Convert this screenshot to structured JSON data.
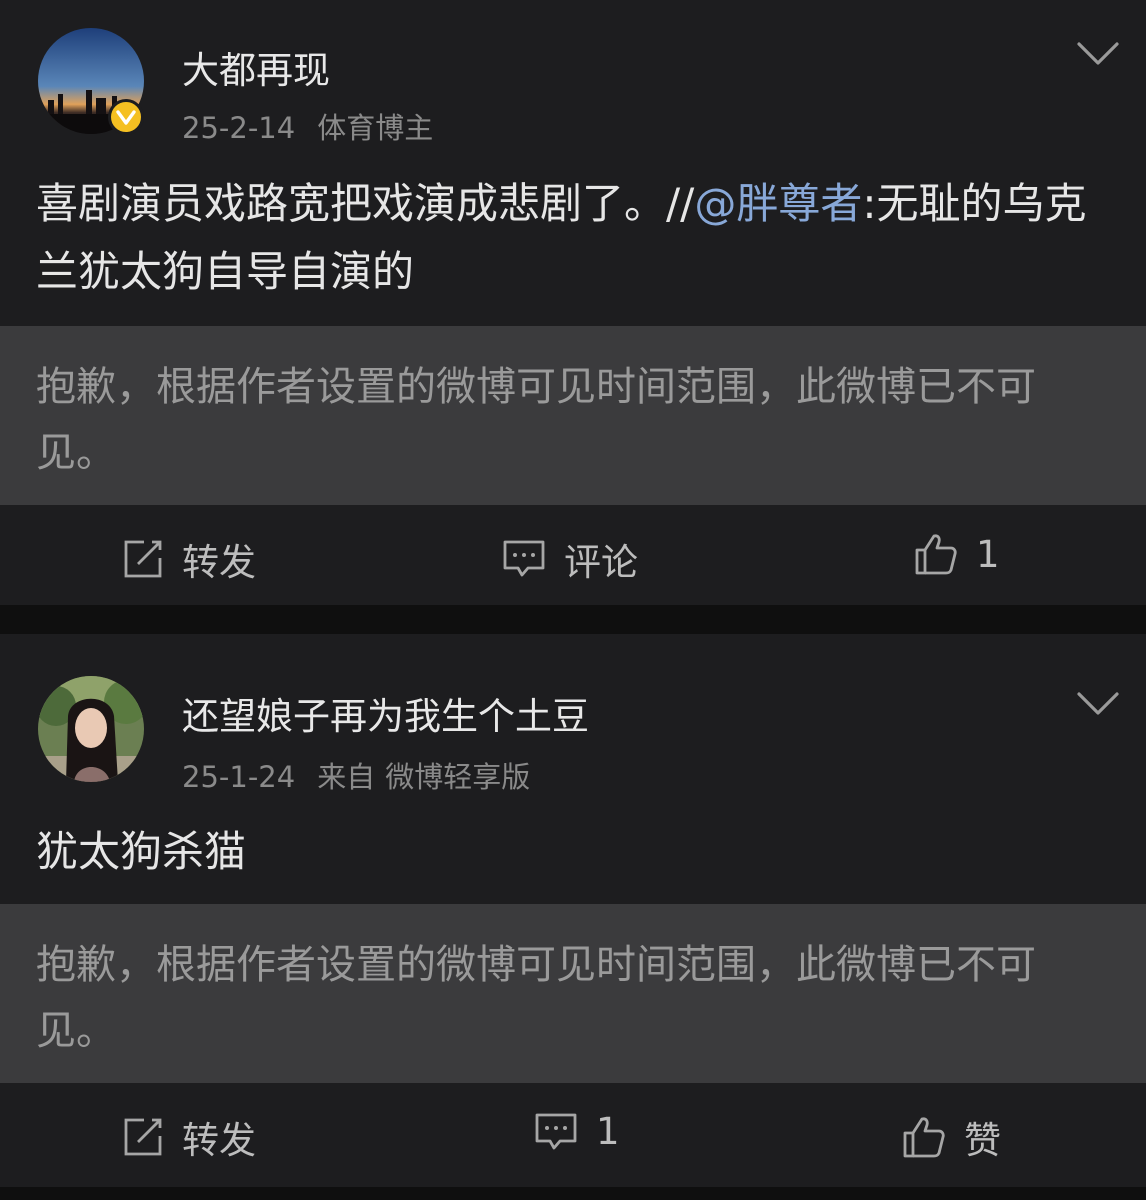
{
  "posts": [
    {
      "author": "大都再现",
      "date": "25-2-14",
      "tag": "体育博主",
      "text_before": "喜剧演员戏路宽把戏演成悲剧了。//",
      "mention": "@胖尊者",
      "text_after": ":无耻的乌克兰犹太狗自导自演的",
      "notice": "抱歉，根据作者设置的微博可见时间范围，此微博已不可见。",
      "actions": {
        "repost": "转发",
        "comment": "评论",
        "like": "1"
      },
      "verified": true
    },
    {
      "author": "还望娘子再为我生个土豆",
      "date": "25-1-24",
      "source_prefix": "来自",
      "source": "微博轻享版",
      "text": "犹太狗杀猫",
      "notice": "抱歉，根据作者设置的微博可见时间范围，此微博已不可见。",
      "actions": {
        "repost": "转发",
        "comment": "1",
        "like": "赞"
      }
    }
  ],
  "colors": {
    "page_bg": "#0f0f0f",
    "card_bg": "#1d1d1f",
    "notice_bg": "#3b3b3d",
    "mention": "#88a8d8",
    "verified_badge": "#f5c022"
  },
  "icons": [
    "verified-badge-icon",
    "chevron-down-icon",
    "repost-icon",
    "comment-icon",
    "like-icon"
  ]
}
